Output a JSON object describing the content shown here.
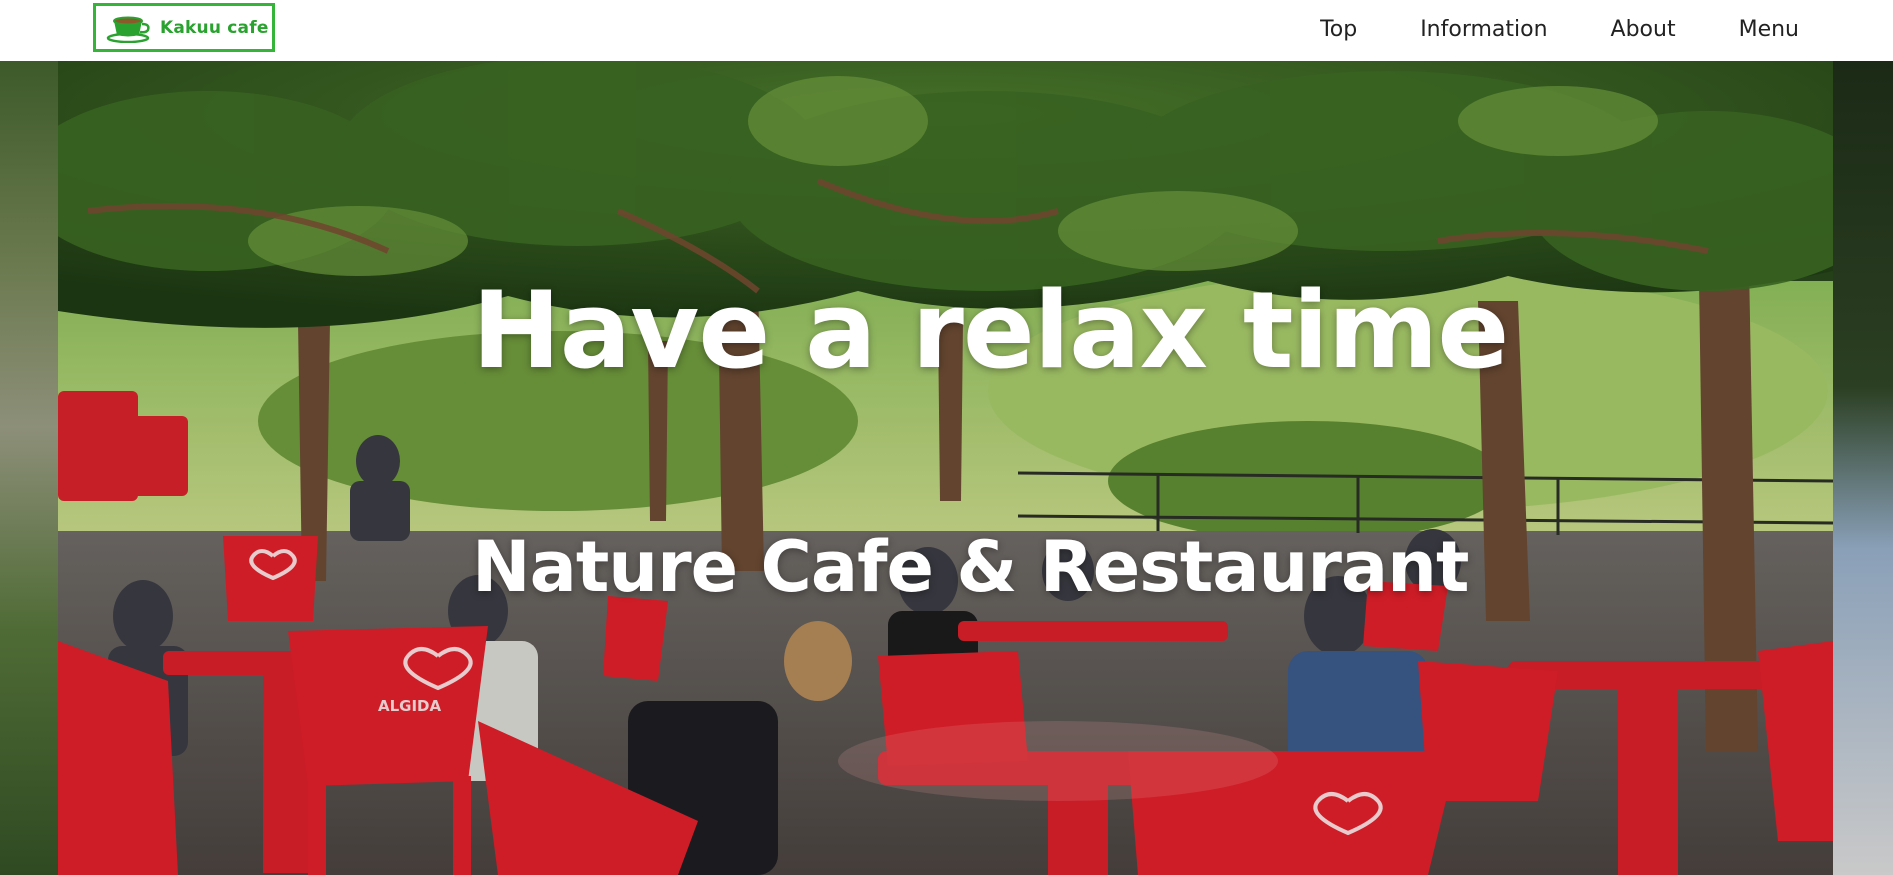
{
  "header": {
    "logo_text": "Kakuu cafe",
    "logo_icon": "coffee-cup-icon",
    "brand_color": "#35b43a",
    "nav": [
      {
        "label": "Top"
      },
      {
        "label": "Information"
      },
      {
        "label": "About"
      },
      {
        "label": "Menu"
      }
    ]
  },
  "hero": {
    "title": "Have a relax time",
    "subtitle": "Nature Cafe & Restaurant",
    "image_subject": "outdoor-cafe-terrace-photo",
    "chair_brand_text": "ALGIDA",
    "accent_colors": {
      "foliage": "#2e5a1f",
      "chairs": "#e0202b"
    }
  }
}
